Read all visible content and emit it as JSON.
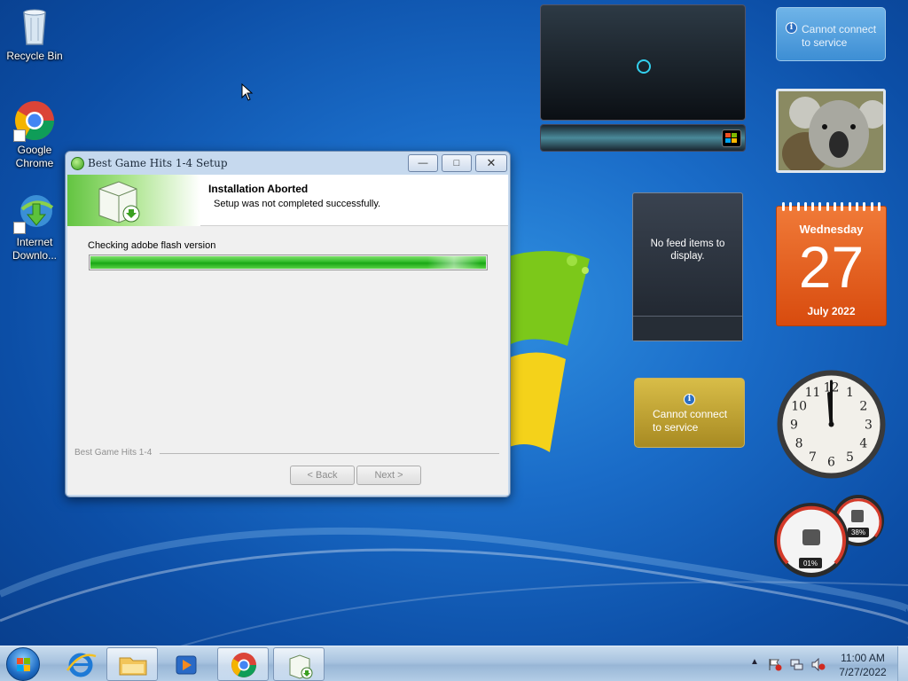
{
  "desktop": {
    "icons": [
      {
        "label": "Recycle Bin"
      },
      {
        "label": "Google Chrome"
      },
      {
        "label": "Internet Downlo..."
      }
    ]
  },
  "dialog": {
    "title": "Best Game Hits 1-4 Setup",
    "header_title": "Installation Aborted",
    "header_subtitle": "Setup was not completed successfully.",
    "status_text": "Checking adobe flash version",
    "progress_percent": 100,
    "brand": "Best Game Hits 1-4",
    "back_label": "< Back",
    "next_label": "Next >"
  },
  "gadgets": {
    "weather_top": "Cannot connect to service",
    "feed_message": "No feed items to display.",
    "calendar": {
      "weekday": "Wednesday",
      "day": "27",
      "month_year": "July 2022"
    },
    "weather_bottom": "Cannot connect to service",
    "meter": {
      "cpu": "01%",
      "memory": "38%"
    },
    "clock_numbers": [
      "12",
      "1",
      "2",
      "3",
      "4",
      "5",
      "6",
      "7",
      "8",
      "9",
      "10",
      "11"
    ]
  },
  "taskbar": {
    "time": "11:00 AM",
    "date": "7/27/2022",
    "items": [
      "start-orb",
      "internet-explorer",
      "windows-explorer",
      "media-player",
      "google-chrome",
      "setup-installer"
    ]
  },
  "colors": {
    "accent_green": "#2fbb28",
    "calendar_orange": "#e25f1c",
    "wallpaper_blue": "#1a6cc8"
  }
}
